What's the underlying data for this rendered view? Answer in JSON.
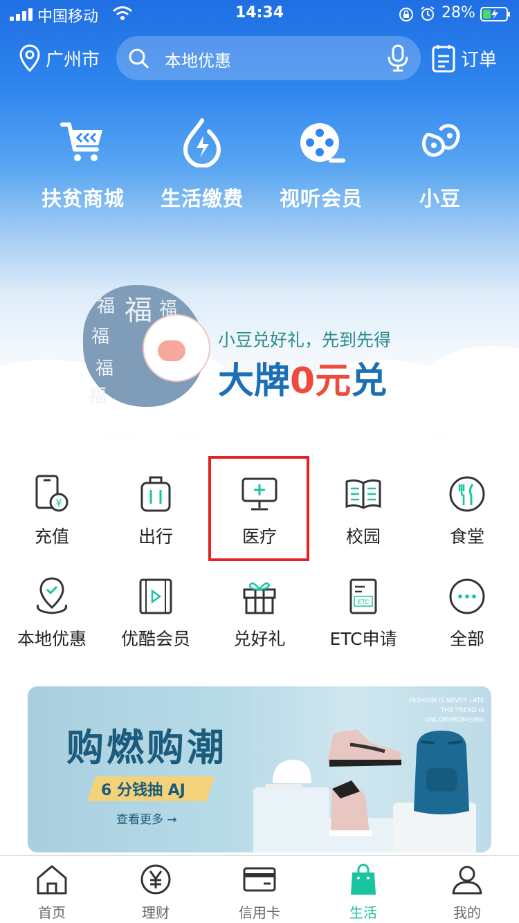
{
  "status_bar": {
    "carrier": "中国移动",
    "time": "14:34",
    "battery": "28%"
  },
  "header": {
    "city": "广州市",
    "search_placeholder": "本地优惠",
    "orders": "订单"
  },
  "quick_actions": [
    {
      "label": "扶贫商城",
      "icon": "cart-icon"
    },
    {
      "label": "生活缴费",
      "icon": "bolt-drop-icon"
    },
    {
      "label": "视听会员",
      "icon": "film-reel-icon"
    },
    {
      "label": "小豆",
      "icon": "bean-icon"
    }
  ],
  "promo": {
    "subtitle": "小豆兑好礼，先到先得",
    "headline_1": "大牌",
    "headline_2": "0元",
    "headline_3": "兑",
    "mascot_text": "福"
  },
  "services": [
    {
      "label": "充值",
      "icon": "phone-topup-icon"
    },
    {
      "label": "出行",
      "icon": "luggage-icon"
    },
    {
      "label": "医疗",
      "icon": "medical-monitor-icon"
    },
    {
      "label": "校园",
      "icon": "book-icon"
    },
    {
      "label": "食堂",
      "icon": "cutlery-icon"
    },
    {
      "label": "本地优惠",
      "icon": "location-check-icon"
    },
    {
      "label": "优酷会员",
      "icon": "video-icon"
    },
    {
      "label": "兑好礼",
      "icon": "gift-icon"
    },
    {
      "label": "ETC申请",
      "icon": "etc-card-icon"
    },
    {
      "label": "全部",
      "icon": "more-dots-icon"
    }
  ],
  "ad": {
    "title": "购燃购潮",
    "tag": "6 分钱抽 AJ",
    "more": "查看更多 →",
    "fine_print_1": "FASHION IS NEVER LATE",
    "fine_print_2": "THE TREND IS UNCOMPROMISING"
  },
  "bottom_nav": [
    {
      "label": "首页",
      "icon": "home-icon"
    },
    {
      "label": "理财",
      "icon": "yuan-icon"
    },
    {
      "label": "信用卡",
      "icon": "credit-card-icon"
    },
    {
      "label": "生活",
      "icon": "shopping-bag-icon"
    },
    {
      "label": "我的",
      "icon": "user-icon"
    }
  ],
  "colors": {
    "brand_blue": "#1f6fe3",
    "accent_green": "#19c4a0",
    "highlight_red": "#e52323"
  }
}
